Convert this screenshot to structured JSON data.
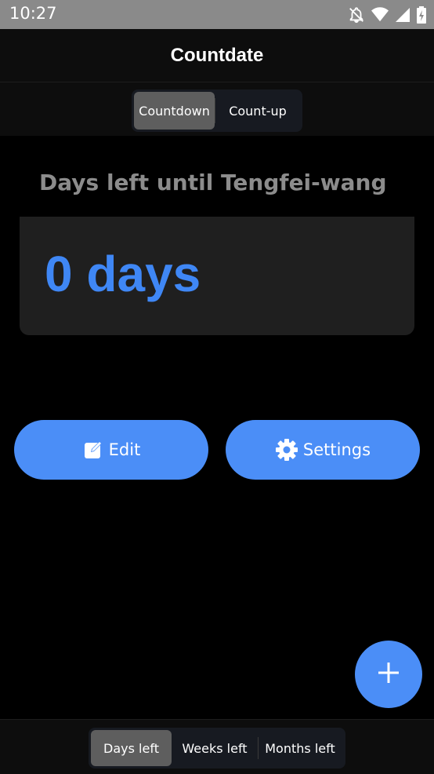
{
  "status_bar": {
    "time": "10:27",
    "icons": [
      "notifications-off-icon",
      "wifi-icon",
      "signal-icon",
      "battery-charging-icon"
    ]
  },
  "app_bar": {
    "title": "Countdate"
  },
  "top_tabs": [
    {
      "label": "Countdown",
      "active": true
    },
    {
      "label": "Count-up",
      "active": false
    }
  ],
  "event": {
    "title": "Days left until Tengfei-wang",
    "count": "0 days"
  },
  "actions": {
    "edit": {
      "label": "Edit",
      "icon": "edit-icon"
    },
    "settings": {
      "label": "Settings",
      "icon": "gear-icon"
    }
  },
  "fab": {
    "icon": "plus-icon"
  },
  "bottom_tabs": [
    {
      "label": "Days left",
      "active": true
    },
    {
      "label": "Weeks left",
      "active": false
    },
    {
      "label": "Months left",
      "active": false
    }
  ],
  "colors": {
    "accent": "#4b8ef7",
    "count_text": "#3f87f5",
    "title_text": "#8c8c8c",
    "card_bg": "#1f1f1f"
  }
}
